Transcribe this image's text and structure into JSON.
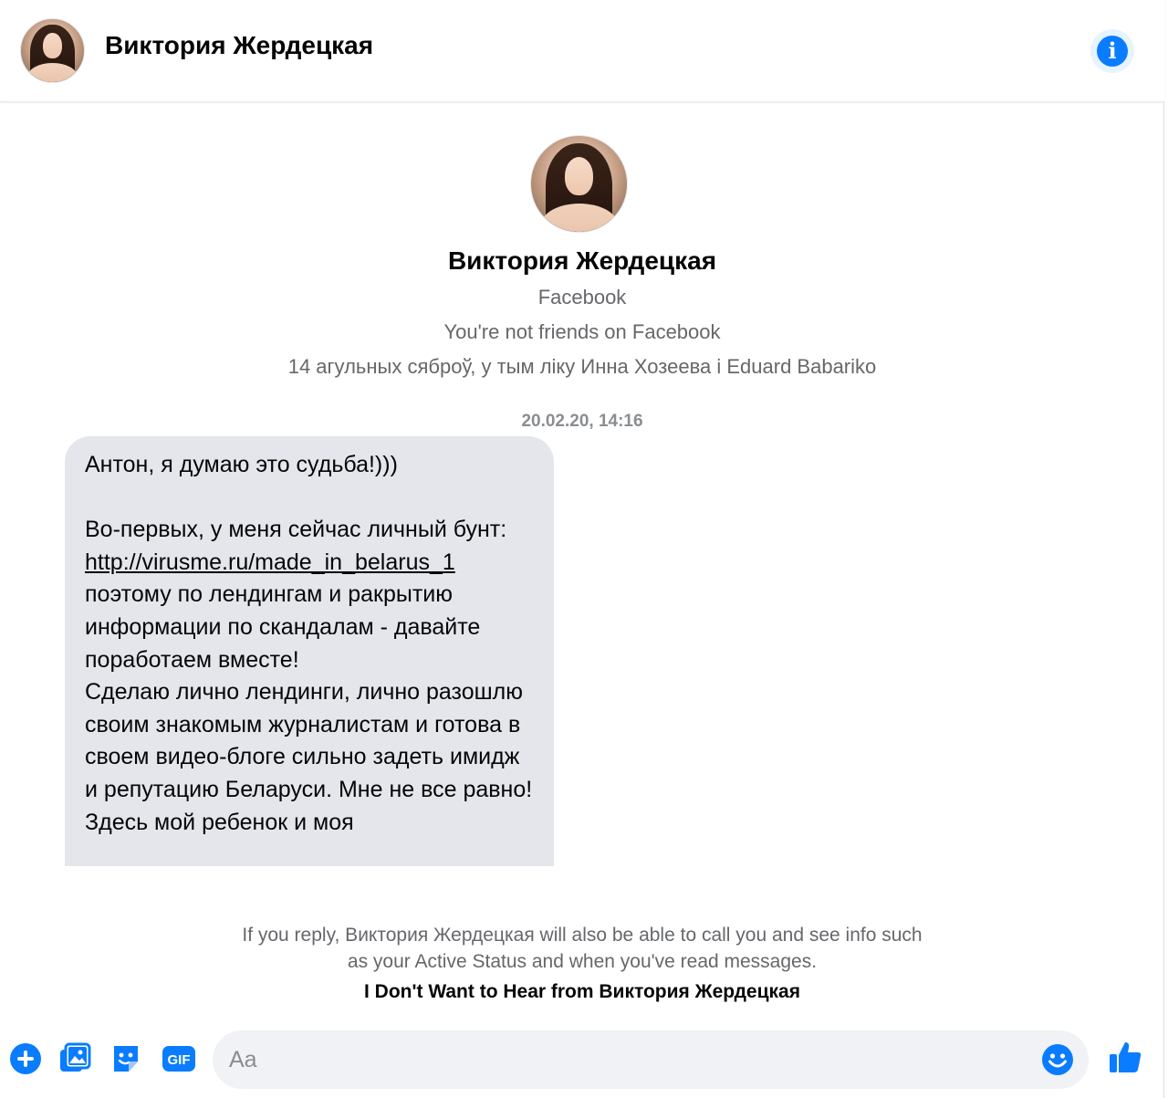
{
  "header": {
    "title": "Виктория Жердецкая"
  },
  "profile": {
    "name": "Виктория Жердецкая",
    "source": "Facebook",
    "friend_status": "You're not friends on Facebook",
    "mutual": "14 агульных сяброў, у тым ліку Инна Хозеева і Eduard Babariko"
  },
  "timestamp": "20.02.20, 14:16",
  "message": {
    "line1": "Антон, я думаю это судьба!)))",
    "para2a": "Во-первых, у меня сейчас личный бунт:",
    "link": "http://virusme.ru/made_in_belarus_1",
    "para2b": "поэтому по лендингам и ракрытию информации по скандалам - давайте поработаем вместе!",
    "para3": "Сделаю лично лендинги, лично разошлю своим знакомым журналистам и готова в своем видео-блоге сильно задеть имидж и репутацию Беларуси. Мне не все равно! Здесь мой ребенок и моя"
  },
  "notice": {
    "text": "If you reply, Виктория Жердецкая will also be able to call you and see info such as your Active Status and when you've read messages.",
    "block_label": "I Don't Want to Hear from Виктория Жердецкая"
  },
  "composer": {
    "placeholder": "Aa"
  },
  "colors": {
    "accent": "#0a7cff",
    "bubble": "#e4e6eb",
    "secondary_text": "#65676b"
  },
  "icons": [
    "info-icon",
    "plus-icon",
    "image-icon",
    "sticker-icon",
    "gif-icon",
    "emoji-icon",
    "thumbs-up-icon"
  ]
}
